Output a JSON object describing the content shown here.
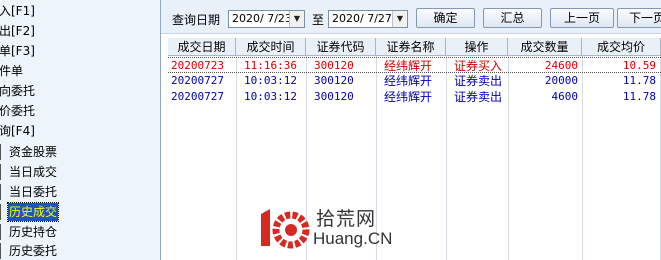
{
  "sidebar": {
    "items": [
      {
        "label": "入[F1]"
      },
      {
        "label": "出[F2]"
      },
      {
        "label": "单[F3]"
      },
      {
        "label": "件单"
      },
      {
        "label": "向委托"
      },
      {
        "label": "价委托"
      },
      {
        "label": "询[F4]"
      },
      {
        "label": "资金股票"
      },
      {
        "label": "当日成交"
      },
      {
        "label": "当日委托"
      },
      {
        "label": "历史成交"
      },
      {
        "label": "历史持仓"
      },
      {
        "label": "历史委托"
      }
    ],
    "selected": "历史成交"
  },
  "toolbar": {
    "query_date_label": "查询日期",
    "start_date": "2020/ 7/23",
    "to_label": "至",
    "end_date": "2020/ 7/27",
    "confirm_label": "确定",
    "summary_label": "汇总",
    "prev_page_label": "上一页",
    "next_page_label": "下一页"
  },
  "table": {
    "columns": [
      "成交日期",
      "成交时间",
      "证券代码",
      "证券名称",
      "操作",
      "成交数量",
      "成交均价"
    ],
    "rows": [
      {
        "date": "20200723",
        "time": "11:16:36",
        "code": "300120",
        "name": "经纬辉开",
        "action": "证券买入",
        "qty": "24600",
        "price": "10.59",
        "color": "red"
      },
      {
        "date": "20200727",
        "time": "10:03:12",
        "code": "300120",
        "name": "经纬辉开",
        "action": "证券卖出",
        "qty": "20000",
        "price": "11.78",
        "color": "blue"
      },
      {
        "date": "20200727",
        "time": "10:03:12",
        "code": "300120",
        "name": "经纬辉开",
        "action": "证券卖出",
        "qty": "4600",
        "price": "11.78",
        "color": "blue"
      }
    ]
  },
  "watermark": {
    "logo_text": "10",
    "cn_text": "拾荒网",
    "en_text": "Huang.CN"
  }
}
